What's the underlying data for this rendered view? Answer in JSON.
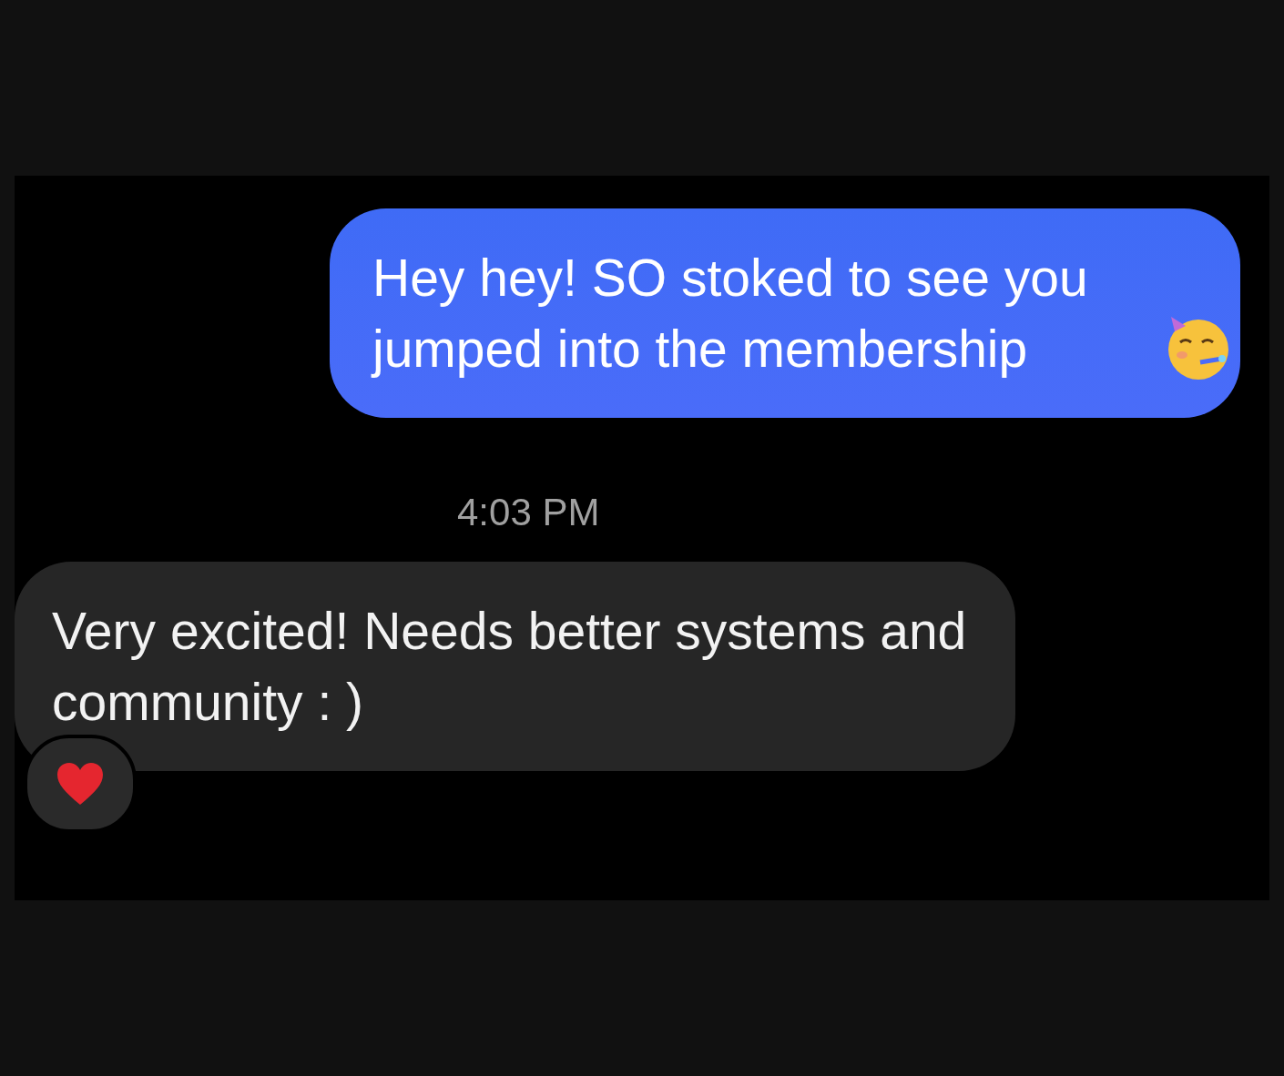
{
  "messages": [
    {
      "kind": "sent",
      "text": "Hey hey! SO stoked to see you jumped into the membership",
      "has_emoji": true,
      "reacted": false
    },
    {
      "kind": "timestamp",
      "text": "4:03 PM"
    },
    {
      "kind": "received",
      "text": "Very excited! Needs better systems and community : )",
      "has_emoji": false,
      "reacted": true
    }
  ]
}
